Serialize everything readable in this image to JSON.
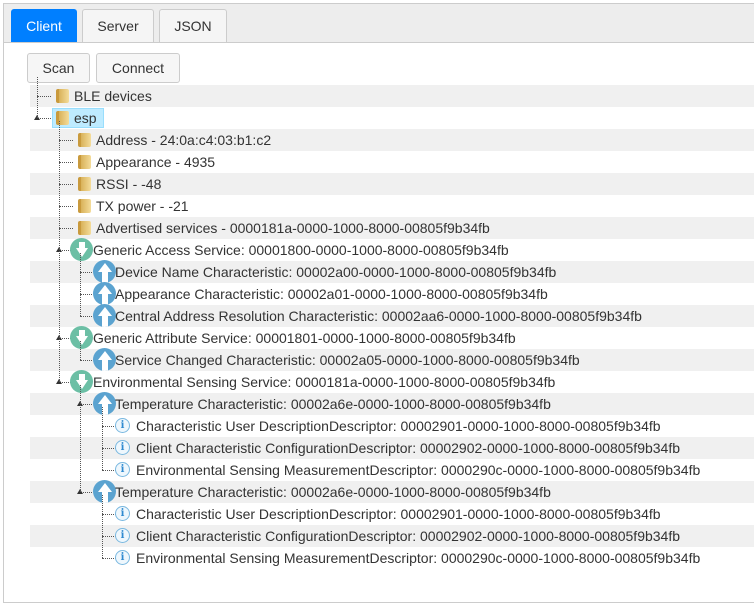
{
  "tabs": [
    {
      "label": "Client",
      "active": true
    },
    {
      "label": "Server",
      "active": false
    },
    {
      "label": "JSON",
      "active": false
    }
  ],
  "toolbar": {
    "scan_label": "Scan",
    "connect_label": "Connect"
  },
  "colors": {
    "accent": "#007fff",
    "service_icon": "#6cbfa5",
    "characteristic_icon": "#5ba3d0",
    "selected": "#beebff"
  },
  "tree": [
    {
      "level": 0,
      "icon": "folder-icon",
      "text": "BLE devices"
    },
    {
      "level": 0,
      "icon": "folder-icon",
      "text": "esp",
      "expanded": true,
      "selected": true
    },
    {
      "level": 1,
      "icon": "folder-icon",
      "text": "Address - 24:0a:c4:03:b1:c2"
    },
    {
      "level": 1,
      "icon": "folder-icon",
      "text": "Appearance - 4935"
    },
    {
      "level": 1,
      "icon": "folder-icon",
      "text": "RSSI - -48"
    },
    {
      "level": 1,
      "icon": "folder-icon",
      "text": "TX power - -21"
    },
    {
      "level": 1,
      "icon": "folder-icon",
      "text": "Advertised services - 0000181a-0000-1000-8000-00805f9b34fb"
    },
    {
      "level": 1,
      "icon": "service-icon",
      "text": "Generic Access Service: 00001800-0000-1000-8000-00805f9b34fb",
      "expanded": true
    },
    {
      "level": 2,
      "icon": "characteristic-icon",
      "text": "Device Name Characteristic: 00002a00-0000-1000-8000-00805f9b34fb"
    },
    {
      "level": 2,
      "icon": "characteristic-icon",
      "text": "Appearance Characteristic: 00002a01-0000-1000-8000-00805f9b34fb"
    },
    {
      "level": 2,
      "icon": "characteristic-icon",
      "text": "Central Address Resolution Characteristic: 00002aa6-0000-1000-8000-00805f9b34fb",
      "last": true
    },
    {
      "level": 1,
      "icon": "service-icon",
      "text": "Generic Attribute Service: 00001801-0000-1000-8000-00805f9b34fb",
      "expanded": true
    },
    {
      "level": 2,
      "icon": "characteristic-icon",
      "text": "Service Changed Characteristic: 00002a05-0000-1000-8000-00805f9b34fb",
      "last": true
    },
    {
      "level": 1,
      "icon": "service-icon",
      "text": "Environmental Sensing Service: 0000181a-0000-1000-8000-00805f9b34fb",
      "expanded": true,
      "last": true
    },
    {
      "level": 2,
      "icon": "characteristic-icon",
      "text": "Temperature Characteristic: 00002a6e-0000-1000-8000-00805f9b34fb",
      "expanded": true
    },
    {
      "level": 3,
      "icon": "info-icon",
      "text": "Characteristic User DescriptionDescriptor: 00002901-0000-1000-8000-00805f9b34fb"
    },
    {
      "level": 3,
      "icon": "info-icon",
      "text": "Client Characteristic ConfigurationDescriptor: 00002902-0000-1000-8000-00805f9b34fb"
    },
    {
      "level": 3,
      "icon": "info-icon",
      "text": "Environmental Sensing MeasurementDescriptor: 0000290c-0000-1000-8000-00805f9b34fb",
      "last": true
    },
    {
      "level": 2,
      "icon": "characteristic-icon",
      "text": "Temperature Characteristic: 00002a6e-0000-1000-8000-00805f9b34fb",
      "expanded": true,
      "last": true
    },
    {
      "level": 3,
      "icon": "info-icon",
      "text": "Characteristic User DescriptionDescriptor: 00002901-0000-1000-8000-00805f9b34fb"
    },
    {
      "level": 3,
      "icon": "info-icon",
      "text": "Client Characteristic ConfigurationDescriptor: 00002902-0000-1000-8000-00805f9b34fb"
    },
    {
      "level": 3,
      "icon": "info-icon",
      "text": "Environmental Sensing MeasurementDescriptor: 0000290c-0000-1000-8000-00805f9b34fb",
      "last": true
    }
  ]
}
